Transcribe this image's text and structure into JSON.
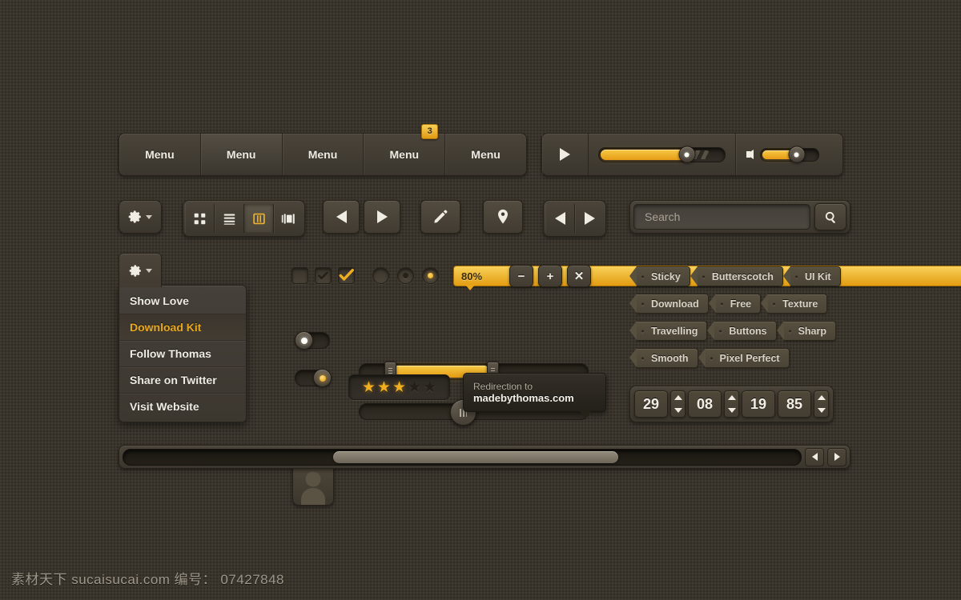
{
  "menubar": {
    "items": [
      {
        "label": "Menu"
      },
      {
        "label": "Menu"
      },
      {
        "label": "Menu"
      },
      {
        "label": "Menu",
        "badge": "3"
      },
      {
        "label": "Menu"
      }
    ]
  },
  "player": {
    "play_icon": "play-icon",
    "progress_percent": 70,
    "buffer_percent": 88,
    "volume_icon": "speaker-icon",
    "volume_percent": 62
  },
  "toolbar": {
    "gear_icon": "gear-icon",
    "view_switcher": [
      {
        "icon": "grid-view-icon",
        "active": false
      },
      {
        "icon": "list-view-icon",
        "active": false
      },
      {
        "icon": "column-view-icon",
        "active": true
      },
      {
        "icon": "coverflow-view-icon",
        "active": false
      }
    ],
    "prev_icon": "arrow-left-icon",
    "next_icon": "arrow-right-icon",
    "edit_icon": "pencil-icon",
    "location_icon": "map-pin-icon"
  },
  "search": {
    "placeholder": "Search",
    "value": "",
    "button_icon": "search-icon"
  },
  "dropdown": {
    "trigger_icon": "gear-icon",
    "items": [
      {
        "label": "Show Love",
        "selected": false
      },
      {
        "label": "Download Kit",
        "selected": true
      },
      {
        "label": "Follow Thomas",
        "selected": false
      },
      {
        "label": "Share on Twitter",
        "selected": false
      },
      {
        "label": "Visit Website",
        "selected": false
      }
    ]
  },
  "controls": {
    "checkboxes": [
      {
        "state": "unchecked"
      },
      {
        "state": "checked-dark"
      },
      {
        "state": "checked-amber"
      }
    ],
    "radios": [
      {
        "state": "empty"
      },
      {
        "state": "dark"
      },
      {
        "state": "amber"
      }
    ],
    "tooltip_value": "80%",
    "buttons": [
      {
        "label": "−",
        "name": "minus-button"
      },
      {
        "label": "+",
        "name": "plus-button"
      },
      {
        "label": "✕",
        "name": "close-button"
      }
    ]
  },
  "toggles": [
    {
      "state": "off",
      "knob": "white"
    },
    {
      "state": "on",
      "knob": "amber"
    }
  ],
  "sliders": {
    "range": {
      "start_percent": 15,
      "end_percent": 56
    },
    "single": {
      "value_percent": 45
    }
  },
  "avatar": {
    "icon": "user-avatar-icon"
  },
  "rating": {
    "value": 3,
    "max": 5
  },
  "tooltip_link": {
    "line1": "Redirection to",
    "line2": "madebythomas.com"
  },
  "tags": [
    [
      "Sticky",
      "Butterscotch",
      "UI Kit"
    ],
    [
      "Download",
      "Free",
      "Texture"
    ],
    [
      "Travelling",
      "Buttons",
      "Sharp"
    ],
    [
      "Smooth",
      "Pixel Perfect"
    ]
  ],
  "date_stepper": {
    "fields": [
      "29",
      "08",
      "19",
      "85"
    ]
  },
  "scrollbar": {
    "thumb_left_percent": 31,
    "thumb_width_percent": 42,
    "left_icon": "arrow-left-icon",
    "right_icon": "arrow-right-icon"
  },
  "watermark": {
    "text": "素材天下 sucaisucai.com  编号： 07427848"
  },
  "colors": {
    "background": "#3a352c",
    "accent": "#edad1f",
    "panel": "#464036",
    "text": "#efece4"
  }
}
